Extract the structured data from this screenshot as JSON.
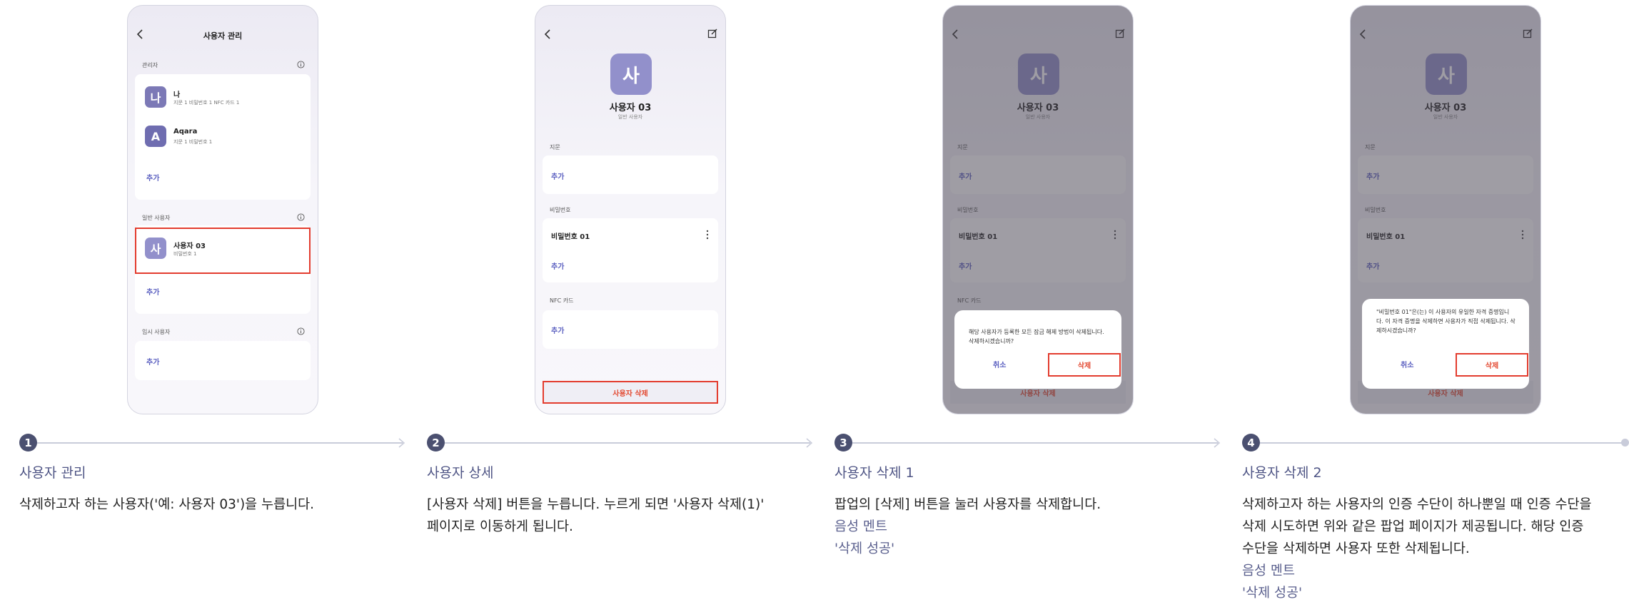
{
  "colors": {
    "accent": "#5a5fc0",
    "highlight": "#e33c2e",
    "step_badge": "#4b5070",
    "step_title": "#4f5585"
  },
  "screen1": {
    "title": "사용자 관리",
    "admin_label": "관리자",
    "admins": [
      {
        "avatar": "나",
        "name": "나",
        "sub": "지문 1 비밀번호 1 NFC 카드 1"
      },
      {
        "avatar": "A",
        "name": "Aqara",
        "sub": "지문 1 비밀번호 1"
      }
    ],
    "add": "추가",
    "normal_label": "일반 사용자",
    "normal_user": {
      "avatar": "사",
      "name": "사용자 03",
      "sub": "비밀번호 1"
    },
    "temp_label": "임시 사용자"
  },
  "detail": {
    "avatar": "사",
    "name": "사용자 03",
    "role": "일반 사용자",
    "fingerprint_label": "지문",
    "add": "추가",
    "password_label": "비밀번호",
    "password_item": "비밀번호 01",
    "nfc_label": "NFC 카드",
    "delete_button": "사용자 삭제"
  },
  "popup3": {
    "message": "해당 사용자가 등록한 모든 잠금 해제 방법이 삭제됩니다. 삭제하시겠습니까?",
    "cancel": "취소",
    "confirm": "삭제"
  },
  "popup4": {
    "message": "\"비밀번호 01\"은(는) 이 사용자의 유일한 자격 증명입니다. 이 자격 증명을 삭제하면 사용자가 직접 삭제됩니다. 삭제하시겠습니까?",
    "cancel": "취소",
    "confirm": "삭제"
  },
  "steps": [
    {
      "num": "1",
      "title": "사용자 관리",
      "desc": [
        "삭제하고자 하는 사용자('예: 사용자 03')을 누릅니다."
      ],
      "voice": []
    },
    {
      "num": "2",
      "title": "사용자 상세",
      "desc": [
        "[사용자 삭제] 버튼을 누릅니다. 누르게 되면 '사용자 삭제(1)'",
        "페이지로 이동하게 됩니다."
      ],
      "voice": []
    },
    {
      "num": "3",
      "title": "사용자 삭제 1",
      "desc": [
        "팝업의 [삭제] 버튼을 눌러 사용자를 삭제합니다."
      ],
      "voice": [
        "음성 멘트",
        "'삭제 성공'"
      ]
    },
    {
      "num": "4",
      "title": "사용자 삭제 2",
      "desc": [
        "삭제하고자 하는 사용자의 인증 수단이 하나뿐일 때 인증 수단을",
        "삭제 시도하면 위와 같은 팝업 페이지가 제공됩니다. 해당 인증",
        "수단을 삭제하면 사용자 또한 삭제됩니다."
      ],
      "voice": [
        "음성 멘트",
        "'삭제 성공'"
      ]
    }
  ]
}
